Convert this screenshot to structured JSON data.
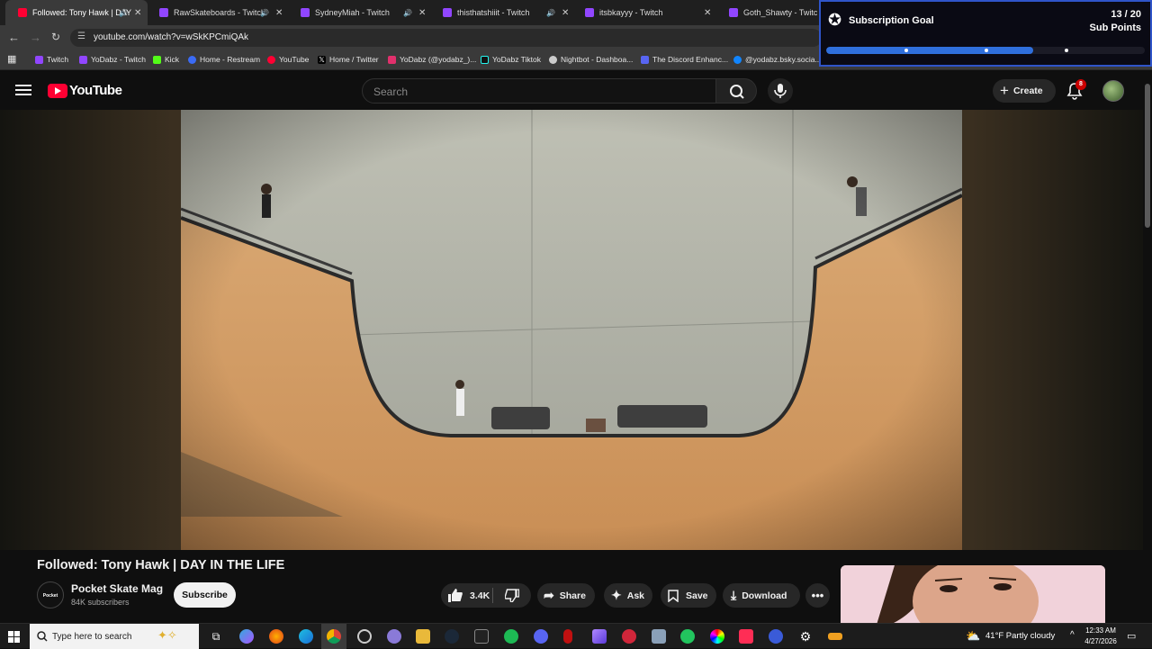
{
  "browser": {
    "tabs": [
      {
        "label": "Followed: Tony Hawk | DAY",
        "active": true,
        "favicon_color": "#ff0033"
      },
      {
        "label": "RawSkateboards - Twitch",
        "favicon_color": "#9146ff"
      },
      {
        "label": "SydneyMiah - Twitch",
        "favicon_color": "#9146ff"
      },
      {
        "label": "thisthatshiiit - Twitch",
        "favicon_color": "#9146ff"
      },
      {
        "label": "itsbkayyy - Twitch",
        "favicon_color": "#9146ff"
      },
      {
        "label": "Goth_Shawty - Twitch",
        "favicon_color": "#9146ff"
      }
    ],
    "url": "youtube.com/watch?v=wSkKPCmiQAk",
    "bookmarks": [
      {
        "label": "Twitch",
        "color": "#9146ff"
      },
      {
        "label": "YoDabz - Twitch",
        "color": "#9146ff"
      },
      {
        "label": "Kick",
        "color": "#53fc18"
      },
      {
        "label": "Home - Restream",
        "color": "#3b6bf5"
      },
      {
        "label": "YouTube",
        "color": "#ff0033"
      },
      {
        "label": "Home / Twitter",
        "color": "#e7e7e7"
      },
      {
        "label": "YoDabz (@yodabz_)...",
        "color": "#e1306c"
      },
      {
        "label": "YoDabz Tiktok",
        "color": "#e7e7e7"
      },
      {
        "label": "Nightbot - Dashboa...",
        "color": "#e7e7e7"
      },
      {
        "label": "The Discord Enhanc...",
        "color": "#5865f2"
      },
      {
        "label": "@yodabz.bsky.socia...",
        "color": "#1185fe"
      }
    ]
  },
  "sub_goal": {
    "title": "Subscription Goal",
    "count": "13 / 20",
    "unit": "Sub Points",
    "current": 13,
    "target": 20
  },
  "youtube": {
    "logo_text": "YouTube",
    "search_placeholder": "Search",
    "create_label": "Create",
    "notifications_count": "8"
  },
  "video": {
    "title": "Followed: Tony Hawk | DAY IN THE LIFE",
    "channel": "Pocket Skate Mag",
    "channel_avatar_text": "Pocket",
    "subscribers": "84K subscribers",
    "subscribe_label": "Subscribe",
    "likes": "3.4K",
    "share_label": "Share",
    "ask_label": "Ask",
    "save_label": "Save",
    "download_label": "Download"
  },
  "taskbar": {
    "search_placeholder": "Type here to search",
    "weather": "41°F  Partly cloudy",
    "time": "12:33 AM",
    "date": "4/27/2026"
  }
}
